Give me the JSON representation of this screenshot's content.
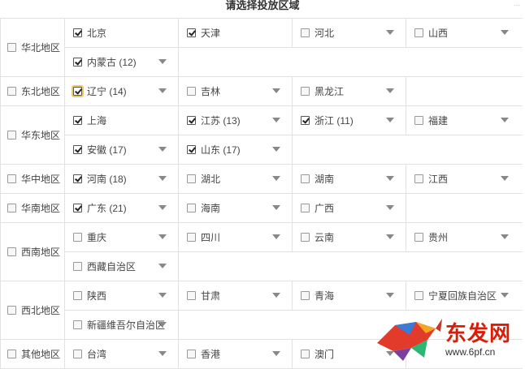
{
  "page": {
    "title": "请选择投放区域",
    "corner_text": "..."
  },
  "regions": [
    {
      "name": "华北地区",
      "checked": false,
      "rows": [
        [
          {
            "label": "北京",
            "checked": true,
            "caret": false
          },
          {
            "label": "天津",
            "checked": true,
            "caret": false
          },
          {
            "label": "河北",
            "checked": false,
            "caret": true
          },
          {
            "label": "山西",
            "checked": false,
            "caret": true
          }
        ],
        [
          {
            "label": "内蒙古 (12)",
            "checked": true,
            "caret": true
          }
        ]
      ]
    },
    {
      "name": "东北地区",
      "checked": false,
      "rows": [
        [
          {
            "label": "辽宁 (14)",
            "checked": true,
            "caret": true,
            "highlight": true
          },
          {
            "label": "吉林",
            "checked": false,
            "caret": true
          },
          {
            "label": "黑龙江",
            "checked": false,
            "caret": true
          }
        ]
      ]
    },
    {
      "name": "华东地区",
      "checked": false,
      "rows": [
        [
          {
            "label": "上海",
            "checked": true,
            "caret": false
          },
          {
            "label": "江苏 (13)",
            "checked": true,
            "caret": true
          },
          {
            "label": "浙江 (11)",
            "checked": true,
            "caret": true
          },
          {
            "label": "福建",
            "checked": false,
            "caret": true
          }
        ],
        [
          {
            "label": "安徽 (17)",
            "checked": true,
            "caret": true
          },
          {
            "label": "山东 (17)",
            "checked": true,
            "caret": true
          }
        ]
      ]
    },
    {
      "name": "华中地区",
      "checked": false,
      "rows": [
        [
          {
            "label": "河南 (18)",
            "checked": true,
            "caret": true
          },
          {
            "label": "湖北",
            "checked": false,
            "caret": true
          },
          {
            "label": "湖南",
            "checked": false,
            "caret": true
          },
          {
            "label": "江西",
            "checked": false,
            "caret": true
          }
        ]
      ]
    },
    {
      "name": "华南地区",
      "checked": false,
      "rows": [
        [
          {
            "label": "广东 (21)",
            "checked": true,
            "caret": true
          },
          {
            "label": "海南",
            "checked": false,
            "caret": true
          },
          {
            "label": "广西",
            "checked": false,
            "caret": true
          }
        ]
      ]
    },
    {
      "name": "西南地区",
      "checked": false,
      "rows": [
        [
          {
            "label": "重庆",
            "checked": false,
            "caret": true
          },
          {
            "label": "四川",
            "checked": false,
            "caret": true
          },
          {
            "label": "云南",
            "checked": false,
            "caret": true
          },
          {
            "label": "贵州",
            "checked": false,
            "caret": true
          }
        ],
        [
          {
            "label": "西藏自治区",
            "checked": false,
            "caret": true
          }
        ]
      ]
    },
    {
      "name": "西北地区",
      "checked": false,
      "rows": [
        [
          {
            "label": "陕西",
            "checked": false,
            "caret": true
          },
          {
            "label": "甘肃",
            "checked": false,
            "caret": true
          },
          {
            "label": "青海",
            "checked": false,
            "caret": true
          },
          {
            "label": "宁夏回族自治区",
            "checked": false,
            "caret": true
          }
        ],
        [
          {
            "label": "新疆维吾尔自治区",
            "checked": false,
            "caret": true
          }
        ]
      ]
    },
    {
      "name": "其他地区",
      "checked": false,
      "rows": [
        [
          {
            "label": "台湾",
            "checked": false,
            "caret": true
          },
          {
            "label": "香港",
            "checked": false,
            "caret": true
          },
          {
            "label": "澳门",
            "checked": false,
            "caret": true
          }
        ]
      ]
    }
  ],
  "watermark": {
    "brand": "东发网",
    "url": "www.6pf.cn",
    "brand_color": "#d81e06"
  },
  "colors": {
    "border": "#e2e2e2",
    "caret": "#888888",
    "highlight": "#f2c66d"
  }
}
